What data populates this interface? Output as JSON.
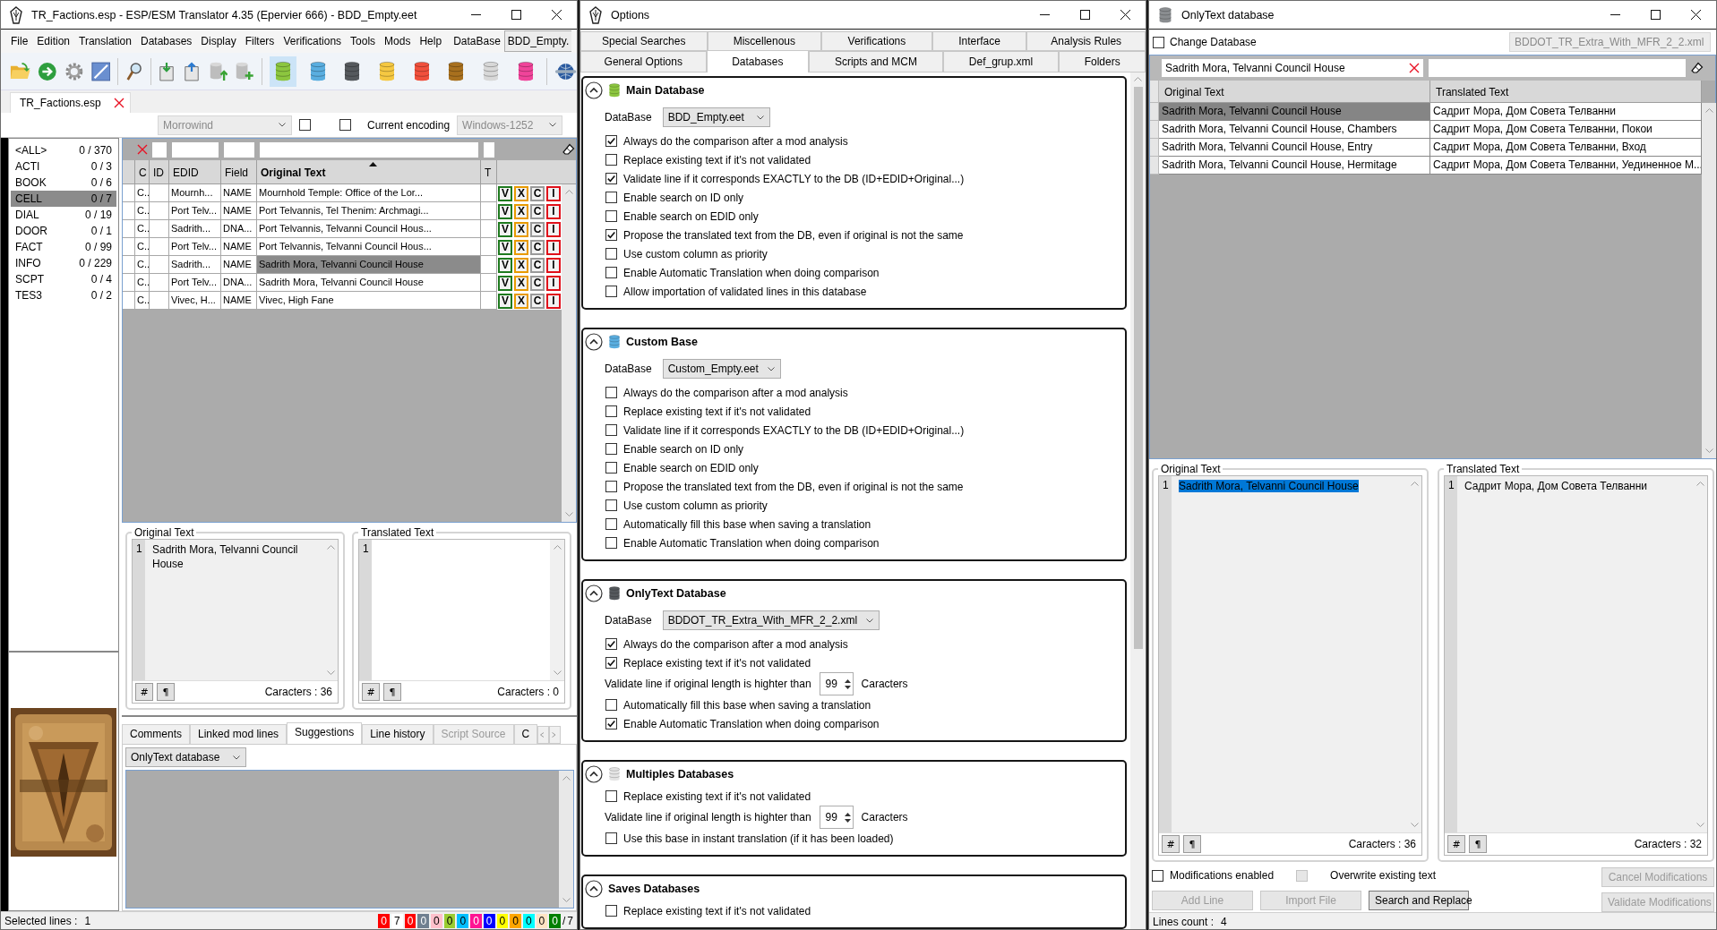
{
  "translator": {
    "window": {
      "title": "TR_Factions.esp - ESP/ESM Translator 4.35 (Epervier 666) - BDD_Empty.eet"
    },
    "menu": [
      "File",
      "Edition",
      "Translation",
      "Databases",
      "Display",
      "Filters",
      "Verifications",
      "Tools",
      "Mods",
      "Help"
    ],
    "database_menu": {
      "label": "DataBase",
      "value": "BDD_Empty."
    },
    "toolbar_databases": [
      {
        "color": "#8cc63f",
        "selected": true
      },
      {
        "color": "#5aaee0",
        "selected": false
      },
      {
        "color": "#55595d",
        "selected": false
      },
      {
        "color": "#f5c842",
        "selected": false
      },
      {
        "color": "#f0503c",
        "selected": false
      },
      {
        "color": "#a8701e",
        "selected": false
      },
      {
        "color": "#d8d8d8",
        "selected": false
      },
      {
        "color": "#f0449a",
        "selected": false
      }
    ],
    "file_tabs": [
      {
        "label": "TR_Factions.esp",
        "selected": true
      }
    ],
    "game_select": {
      "value": "Morrowind",
      "disabled": true
    },
    "option_checkbox": {
      "checked": false
    },
    "encoding": {
      "label": "Current encoding",
      "checked": false,
      "value": "Windows-1252",
      "disabled": true
    },
    "categories": [
      {
        "name": "<ALL>",
        "count": "0 / 370",
        "selected": false
      },
      {
        "name": "ACTI",
        "count": "0 / 3",
        "selected": false
      },
      {
        "name": "BOOK",
        "count": "0 / 6",
        "selected": false
      },
      {
        "name": "CELL",
        "count": "0 / 7",
        "selected": true
      },
      {
        "name": "DIAL",
        "count": "0 / 19",
        "selected": false
      },
      {
        "name": "DOOR",
        "count": "0 / 1",
        "selected": false
      },
      {
        "name": "FACT",
        "count": "0 / 99",
        "selected": false
      },
      {
        "name": "INFO",
        "count": "0 / 229",
        "selected": false
      },
      {
        "name": "SCPT",
        "count": "0 / 4",
        "selected": false
      },
      {
        "name": "TES3",
        "count": "0 / 2",
        "selected": false
      }
    ],
    "grid": {
      "columns": [
        {
          "label": "C"
        },
        {
          "label": "ID"
        },
        {
          "label": "EDID"
        },
        {
          "label": "Field"
        },
        {
          "label": "Original Text",
          "sorted": true
        },
        {
          "label": "T"
        }
      ],
      "rows": [
        {
          "column_1": "C..",
          "edid": "Mournh...",
          "field": "NAME",
          "original_text": "Mournhold Temple: Office of the Lor...",
          "selected": false,
          "actions": [
            "V",
            "X",
            "C",
            "I"
          ]
        },
        {
          "column_1": "C..",
          "edid": "Port Telv...",
          "field": "NAME",
          "original_text": "Port Telvannis, Tel Thenim: Archmagi...",
          "selected": false,
          "actions": [
            "V",
            "X",
            "C",
            "I"
          ]
        },
        {
          "column_1": "C..",
          "edid": "Sadrith...",
          "field": "DNA...",
          "original_text": "Port Telvannis, Telvanni Council Hous...",
          "selected": false,
          "actions": [
            "V",
            "X",
            "C",
            "I"
          ]
        },
        {
          "column_1": "C..",
          "edid": "Port Telv...",
          "field": "NAME",
          "original_text": "Port Telvannis, Telvanni Council Hous...",
          "selected": false,
          "actions": [
            "V",
            "X",
            "C",
            "I"
          ]
        },
        {
          "column_1": "C..",
          "edid": "Sadrith...",
          "field": "NAME",
          "original_text": "Sadrith Mora, Telvanni Council House",
          "selected": true,
          "actions": [
            "V",
            "X",
            "C",
            "I"
          ]
        },
        {
          "column_1": "C..",
          "edid": "Port Telv...",
          "field": "DNA...",
          "original_text": "Sadrith Mora, Telvanni Council House",
          "selected": false,
          "actions": [
            "V",
            "X",
            "C",
            "I"
          ]
        },
        {
          "column_1": "C..",
          "edid": "Vivec, H...",
          "field": "NAME",
          "original_text": "Vivec, High Fane",
          "selected": false,
          "actions": [
            "V",
            "X",
            "C",
            "I"
          ]
        }
      ]
    },
    "editors": [
      {
        "label": "Original Text",
        "line_number": "1",
        "value": "Sadrith Mora, Telvanni Council House",
        "readonly": true,
        "buttons": [
          "#",
          "¶"
        ],
        "count": "Caracters : 36"
      },
      {
        "label": "Translated Text",
        "line_number": "1",
        "readonly": false,
        "buttons": [
          "#",
          "¶"
        ],
        "count": "Caracters : 0"
      }
    ],
    "bottom_tabs": [
      {
        "label": "Comments",
        "selected": false,
        "disabled": false
      },
      {
        "label": "Linked mod lines",
        "selected": false,
        "disabled": false
      },
      {
        "label": "Suggestions",
        "selected": true,
        "disabled": false
      },
      {
        "label": "Line history",
        "selected": false,
        "disabled": false
      },
      {
        "label": "Script Source",
        "selected": false,
        "disabled": true
      },
      {
        "label": "C",
        "selected": false,
        "disabled": false
      }
    ],
    "suggestion_source": {
      "value": "OnlyText database"
    },
    "status": {
      "label": "Selected lines :",
      "value": "1",
      "counters": [
        {
          "text": "0",
          "color": "#ff0000"
        },
        {
          "text": "7",
          "color": "#ffffff"
        },
        {
          "text": "0",
          "color": "#ff0000"
        },
        {
          "text": "0",
          "color": "#708090"
        },
        {
          "text": "0",
          "color": "#ffc0cb"
        },
        {
          "text": "0",
          "color": "#9acd32"
        },
        {
          "text": "0",
          "color": "#00bfff"
        },
        {
          "text": "0",
          "color": "#ff1493"
        },
        {
          "text": "0",
          "color": "#0000ff"
        },
        {
          "text": "0",
          "color": "#ffff00"
        },
        {
          "text": "0",
          "color": "#ffa500"
        },
        {
          "text": "0",
          "color": "#00ffff"
        },
        {
          "text": "0",
          "color": "#ffe4c4"
        },
        {
          "text": "0",
          "color": "#008000"
        }
      ],
      "separator": "/",
      "total": "7"
    }
  },
  "options": {
    "window": {
      "title": "Options"
    },
    "tab_rows": [
      [
        {
          "label": "Special Searches",
          "selected": false
        },
        {
          "label": "Miscellenous",
          "selected": false
        },
        {
          "label": "Verifications",
          "selected": false
        },
        {
          "label": "Interface",
          "selected": false
        },
        {
          "label": "Analysis Rules",
          "selected": false
        }
      ],
      [
        {
          "label": "General Options",
          "selected": false
        },
        {
          "label": "Databases",
          "selected": true
        },
        {
          "label": "Scripts and MCM",
          "selected": false
        },
        {
          "label": "Def_grup.xml",
          "selected": false
        },
        {
          "label": "Folders",
          "selected": false
        }
      ]
    ],
    "sections": [
      {
        "title": "Main Database",
        "color": "#8cc63f",
        "expanded": true,
        "database": {
          "label": "DataBase",
          "value": "BDD_Empty.eet"
        },
        "items": [
          {
            "kind": "checkbox",
            "label": "Always do the comparison after a mod analysis",
            "checked": true
          },
          {
            "kind": "checkbox",
            "label": "Replace existing text if it's not validated",
            "checked": false
          },
          {
            "kind": "checkbox",
            "label": "Validate line if it corresponds EXACTLY to the DB (ID+EDID+Original...)",
            "checked": true
          },
          {
            "kind": "checkbox",
            "label": "Enable search on ID only",
            "checked": false
          },
          {
            "kind": "checkbox",
            "label": "Enable search on EDID only",
            "checked": false
          },
          {
            "kind": "checkbox",
            "label": "Propose the translated text from the DB, even if original is not the same",
            "checked": true
          },
          {
            "kind": "checkbox",
            "label": "Use custom column as priority",
            "checked": false
          },
          {
            "kind": "checkbox",
            "label": "Enable Automatic Translation when doing comparison",
            "checked": false
          },
          {
            "kind": "checkbox",
            "label": "Allow importation of validated lines in this database",
            "checked": false
          }
        ]
      },
      {
        "title": "Custom Base",
        "color": "#5aaee0",
        "expanded": true,
        "database": {
          "label": "DataBase",
          "value": "Custom_Empty.eet"
        },
        "items": [
          {
            "kind": "checkbox",
            "label": "Always do the comparison after a mod analysis",
            "checked": false
          },
          {
            "kind": "checkbox",
            "label": "Replace existing text if it's not validated",
            "checked": false
          },
          {
            "kind": "checkbox",
            "label": "Validate line if it corresponds EXACTLY to the DB (ID+EDID+Original...)",
            "checked": false
          },
          {
            "kind": "checkbox",
            "label": "Enable search on ID only",
            "checked": false
          },
          {
            "kind": "checkbox",
            "label": "Enable search on EDID only",
            "checked": false
          },
          {
            "kind": "checkbox",
            "label": "Propose the translated text from the DB, even if original is not the same",
            "checked": false
          },
          {
            "kind": "checkbox",
            "label": "Use custom column as priority",
            "checked": false
          },
          {
            "kind": "checkbox",
            "label": "Automatically fill this base when saving a translation",
            "checked": false
          },
          {
            "kind": "checkbox",
            "label": "Enable Automatic Translation when doing comparison",
            "checked": false
          }
        ]
      },
      {
        "title": "OnlyText Database",
        "color": "#55595d",
        "expanded": true,
        "database": {
          "label": "DataBase",
          "value": "BDDOT_TR_Extra_With_MFR_2_2.xml"
        },
        "items": [
          {
            "kind": "checkbox",
            "label": "Always do the comparison after a mod analysis",
            "checked": true
          },
          {
            "kind": "checkbox",
            "label": "Replace existing text if it's not validated",
            "checked": true
          },
          {
            "kind": "number",
            "label": "Validate line if original length is highter than",
            "value": "99",
            "unit": "Caracters"
          },
          {
            "kind": "checkbox",
            "label": "Automatically fill this base when saving a translation",
            "checked": false
          },
          {
            "kind": "checkbox",
            "label": "Enable Automatic Translation when doing comparison",
            "checked": true
          }
        ]
      },
      {
        "title": "Multiples Databases",
        "color": "#e4e4e4",
        "expanded": true,
        "items": [
          {
            "kind": "checkbox",
            "label": "Replace existing text if it's not validated",
            "checked": false
          },
          {
            "kind": "number",
            "label": "Validate line if original length is highter than",
            "value": "99",
            "unit": "Caracters"
          },
          {
            "kind": "checkbox",
            "label": "Use this base in instant translation (if it has been loaded)",
            "checked": false
          }
        ]
      },
      {
        "title": "Saves Databases",
        "expanded": true,
        "items": [
          {
            "kind": "checkbox",
            "label": "Replace existing text if it's not validated",
            "checked": false
          }
        ]
      }
    ]
  },
  "onlytext": {
    "window": {
      "title": "OnlyText database"
    },
    "change_database": {
      "label": "Change Database",
      "checked": false
    },
    "database_select": {
      "value": "BDDOT_TR_Extra_With_MFR_2_2.xml",
      "disabled": true
    },
    "filter": {
      "value": "Sadrith Mora, Telvanni Council House"
    },
    "table": {
      "columns": [
        "Original Text",
        "Translated Text"
      ],
      "rows": [
        {
          "original": "Sadrith Mora, Telvanni Council House",
          "translated": "Садрит Мора, Дом Совета Телванни",
          "selected": true
        },
        {
          "original": "Sadrith Mora, Telvanni Council House, Chambers",
          "translated": "Садрит Мора, Дом Совета Телванни, Покои",
          "selected": false
        },
        {
          "original": "Sadrith Mora, Telvanni Council House, Entry",
          "translated": "Садрит Мора, Дом Совета Телванни, Вход",
          "selected": false
        },
        {
          "original": "Sadrith Mora, Telvanni Council House, Hermitage",
          "translated": "Садрит Мора, Дом Совета Телванни, Уединенное М...",
          "selected": false
        }
      ]
    },
    "editors": [
      {
        "label": "Original Text",
        "line_number": "1",
        "value": "Sadrith Mora, Telvanni Council House",
        "readonly": true,
        "highlighted": true,
        "buttons": [
          "#",
          "¶"
        ],
        "count": "Caracters : 36"
      },
      {
        "label": "Translated Text",
        "line_number": "1",
        "value": "Садрит Мора, Дом Совета Телванни",
        "readonly": true,
        "highlighted": false,
        "buttons": [
          "#",
          "¶"
        ],
        "count": "Caracters : 32"
      }
    ],
    "checkboxes": [
      {
        "label": "Modifications enabled",
        "checked": false,
        "disabled": false
      },
      {
        "label": "Overwrite existing text",
        "checked": false,
        "disabled": true
      }
    ],
    "buttons": [
      {
        "label": "Add Line",
        "disabled": true
      },
      {
        "label": "Import File",
        "disabled": true
      },
      {
        "label": "Search and Replace",
        "disabled": false
      }
    ],
    "side_buttons": [
      {
        "label": "Cancel Modifications",
        "disabled": true
      },
      {
        "label": "Validate Modifications",
        "disabled": true
      }
    ],
    "status": {
      "label": "Lines count :",
      "value": "4"
    }
  }
}
